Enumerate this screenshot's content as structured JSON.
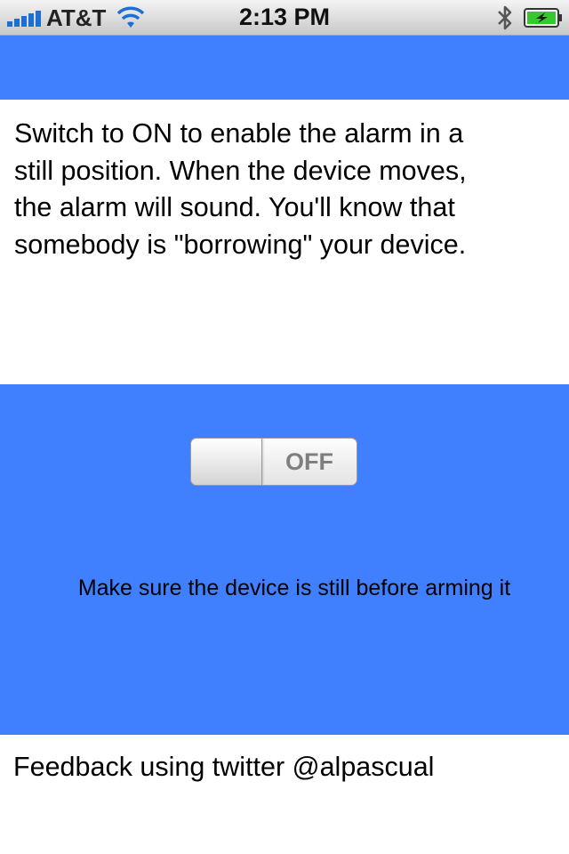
{
  "status_bar": {
    "carrier": "AT&T",
    "time": "2:13 PM",
    "signal_icon": "signal-bars-icon",
    "wifi_icon": "wifi-icon",
    "bluetooth_icon": "bluetooth-icon",
    "battery_icon": "battery-charging-icon"
  },
  "description": {
    "text": "Switch to ON to enable the alarm in a\nstill position. When the device moves,\nthe alarm will sound. You'll know that\nsomebody is \"borrowing\" your device."
  },
  "alarm_switch": {
    "label": "OFF",
    "state": "off"
  },
  "hint": {
    "text": "Make sure the device is still before arming it"
  },
  "footer": {
    "feedback_text": "Feedback using twitter @alpascual"
  },
  "colors": {
    "panel_blue": "#4080ff",
    "background": "#ffffff",
    "text": "#000000",
    "switch_label": "#7f7f7f",
    "battery_green": "#35c92f"
  }
}
